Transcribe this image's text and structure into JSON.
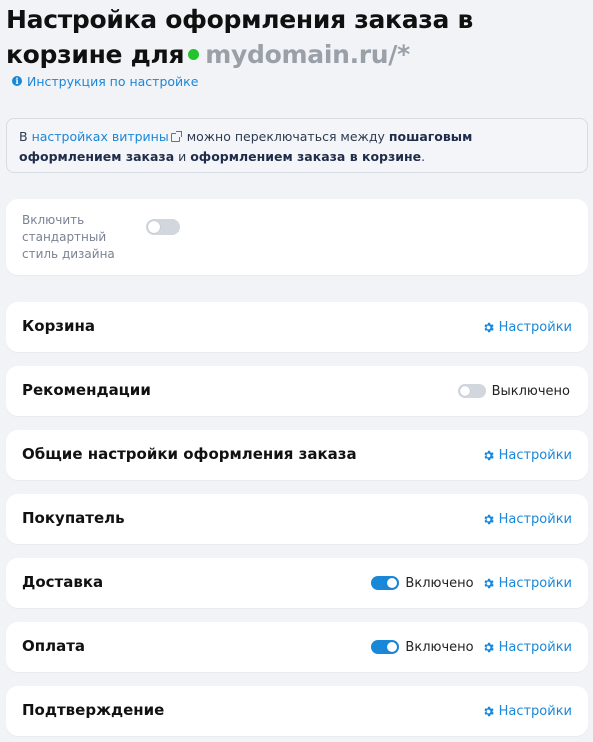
{
  "header": {
    "title": "Настройка оформления заказа в корзине для",
    "domain": "mydomain.ru/*",
    "help_link": "Инструкция по настройке"
  },
  "notice": {
    "prefix": "В ",
    "link": "настройках витрины",
    "middle": " можно переключаться между ",
    "bold1": "пошаговым оформлением заказа",
    "and": " и ",
    "bold2": "оформлением заказа в корзине",
    "suffix": "."
  },
  "style_toggle": {
    "label": "Включить стандартный стиль дизайна",
    "enabled": false
  },
  "sections": [
    {
      "title": "Корзина",
      "settings_label": "Настройки"
    },
    {
      "title": "Рекомендации",
      "toggle": "off",
      "state_label": "Выключено"
    },
    {
      "title": "Общие настройки оформления заказа",
      "settings_label": "Настройки"
    },
    {
      "title": "Покупатель",
      "settings_label": "Настройки"
    },
    {
      "title": "Доставка",
      "toggle": "on",
      "state_label": "Включено",
      "settings_label": "Настройки"
    },
    {
      "title": "Оплата",
      "toggle": "on",
      "state_label": "Включено",
      "settings_label": "Настройки"
    },
    {
      "title": "Подтверждение",
      "settings_label": "Настройки"
    }
  ],
  "colors": {
    "accent": "#1a87d8",
    "status_dot": "#22c32c",
    "background": "#f2f3f7"
  }
}
